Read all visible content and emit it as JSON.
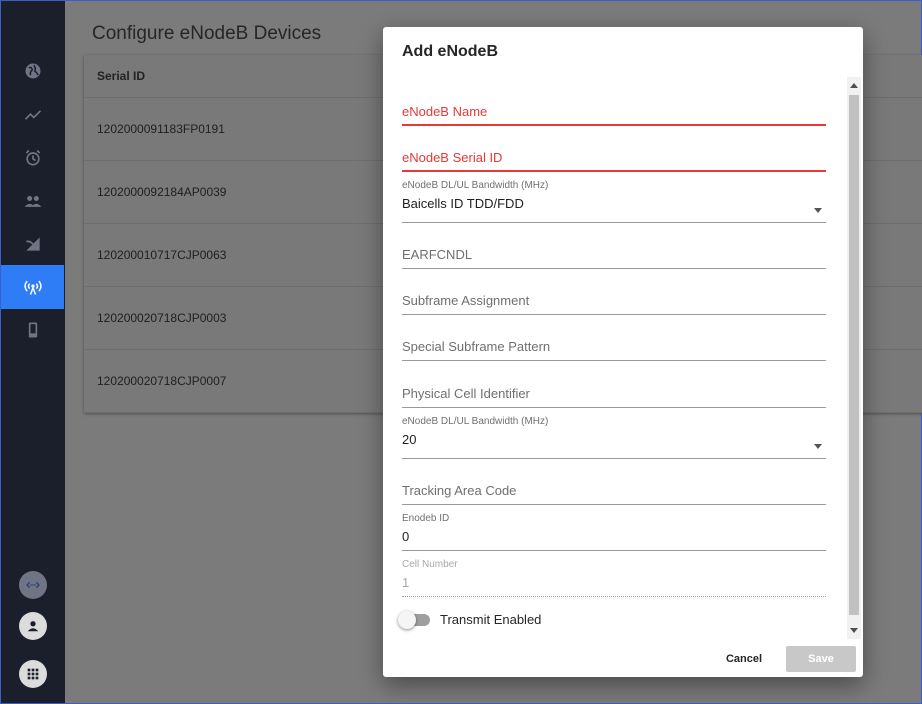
{
  "page": {
    "title": "Configure eNodeB Devices",
    "table": {
      "header": "Serial ID",
      "rows": [
        "1202000091183FP0191",
        "1202000092184AP0039",
        "120200010717CJP0063",
        "120200020718CJP0003",
        "120200020718CJP0007"
      ]
    }
  },
  "sidebar": {
    "items": [
      "globe-icon",
      "chart-line-icon",
      "alarm-icon",
      "people-icon",
      "signal-icon",
      "antenna-icon",
      "phone-icon"
    ],
    "active": "antenna-icon",
    "bottom": [
      "network-icon",
      "account-icon",
      "apps-icon"
    ],
    "active_color": "#2f7df6"
  },
  "dialog": {
    "title": "Add eNodeB",
    "fields": {
      "name_label": "eNodeB Name",
      "serial_label": "eNodeB Serial ID",
      "device_class_label": "eNodeB DL/UL Bandwidth (MHz)",
      "device_class_value": "Baicells ID TDD/FDD",
      "earfcndl_label": "EARFCNDL",
      "subframe_label": "Subframe Assignment",
      "special_subframe_label": "Special Subframe Pattern",
      "pci_label": "Physical Cell Identifier",
      "bandwidth_label": "eNodeB DL/UL Bandwidth (MHz)",
      "bandwidth_value": "20",
      "tac_label": "Tracking Area Code",
      "enodeb_id_label": "Enodeb ID",
      "enodeb_id_value": "0",
      "cell_number_label": "Cell Number",
      "cell_number_value": "1"
    },
    "toggle_label": "Transmit Enabled",
    "cancel_label": "Cancel",
    "save_label": "Save",
    "error_color": "#e53935"
  }
}
